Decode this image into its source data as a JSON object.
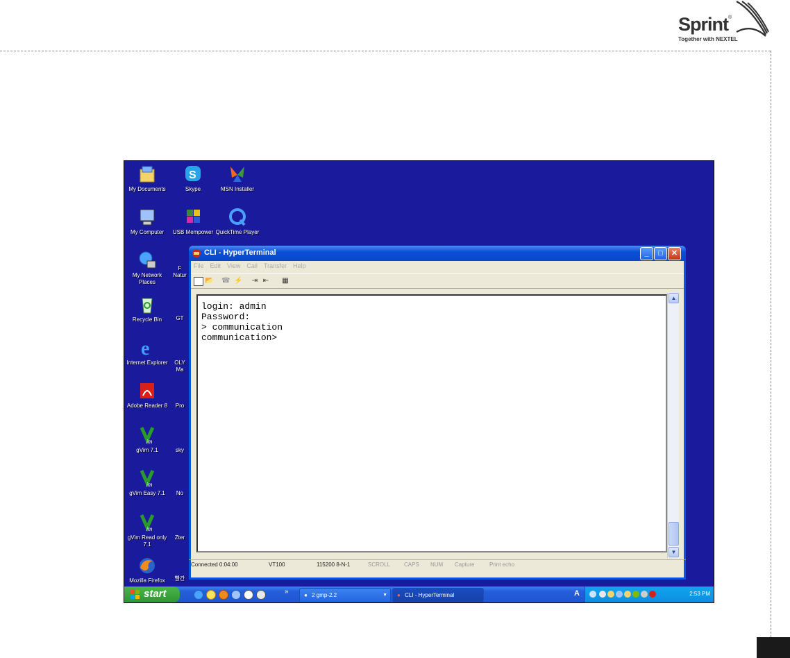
{
  "logo": {
    "wordmark": "Sprint",
    "registered": "®",
    "tagline": "Together with NEXTEL"
  },
  "desktop": {
    "icons": [
      {
        "label": "My Documents",
        "icon": "my-documents-icon"
      },
      {
        "label": "Skype",
        "icon": "skype-icon"
      },
      {
        "label": "MSN Installer",
        "icon": "msn-butterfly-icon"
      },
      {
        "label": "My Computer",
        "icon": "my-computer-icon"
      },
      {
        "label": "USB Mempower",
        "icon": "usb-mempower-icon"
      },
      {
        "label": "QuickTime Player",
        "icon": "quicktime-icon"
      },
      {
        "label": "My Network Places",
        "icon": "network-places-icon"
      },
      {
        "label": "Recycle Bin",
        "icon": "recycle-bin-icon"
      },
      {
        "label": "Internet Explorer",
        "icon": "internet-explorer-icon"
      },
      {
        "label": "Adobe Reader 8",
        "icon": "adobe-reader-icon"
      },
      {
        "label": "gVim 7.1",
        "icon": "gvim-icon"
      },
      {
        "label": "gVim Easy 7.1",
        "icon": "gvim-icon"
      },
      {
        "label": "gVim Read only 7.1",
        "icon": "gvim-icon"
      },
      {
        "label": "Mozilla Firefox",
        "icon": "firefox-icon"
      }
    ],
    "partial_labels": [
      "F",
      "Natur",
      "GT",
      "OLY",
      "Ma",
      "Pro",
      "sky",
      "No",
      "Zter",
      "빨간"
    ]
  },
  "window": {
    "title": "CLI - HyperTerminal",
    "menu": [
      "File",
      "Edit",
      "View",
      "Call",
      "Transfer",
      "Help"
    ],
    "terminal_lines": [
      "login: admin",
      "Password:",
      "> communication",
      "communication>"
    ],
    "status": {
      "connected": "Connected 0:04:00",
      "emulation": "VT100",
      "settings": "115200 8-N-1",
      "scroll": "SCROLL",
      "caps": "CAPS",
      "num": "NUM",
      "capture": "Capture",
      "print_echo": "Print echo"
    }
  },
  "taskbar": {
    "start_label": "start",
    "tasks": [
      {
        "label": "2 gmp-2.2",
        "icon": "gimp-icon"
      },
      {
        "label": "CLI - HyperTerminal",
        "icon": "hyperterminal-icon"
      }
    ],
    "clock": "2:53 PM"
  }
}
